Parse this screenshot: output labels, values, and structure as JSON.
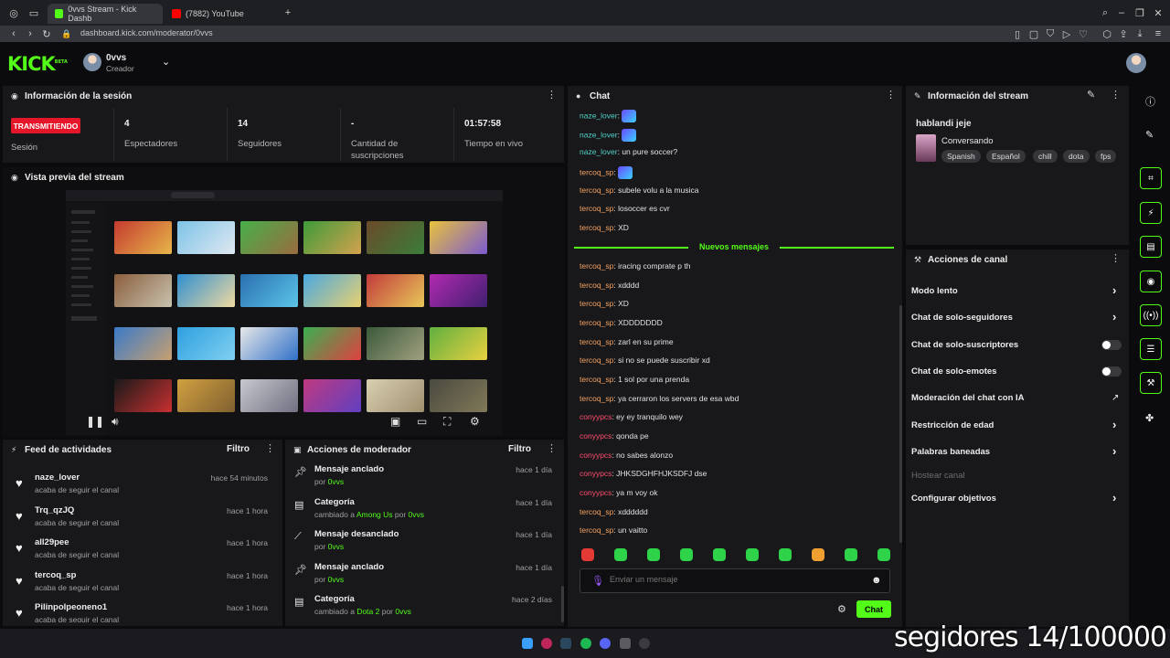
{
  "browser": {
    "tabs": [
      {
        "label": "0vvs Stream - Kick Dashb",
        "active": true
      },
      {
        "label": "(7882) YouTube",
        "active": false
      }
    ],
    "url": "dashboard.kick.com/moderator/0vvs"
  },
  "header": {
    "logo": "KICK",
    "logo_badge": "BETA",
    "user_name": "0vvs",
    "user_role": "Creador"
  },
  "session": {
    "title": "Información de la sesión",
    "live_badge": "TRANSMITIENDO",
    "live_label": "Sesión",
    "stats": [
      {
        "value": "4",
        "label": "Espectadores"
      },
      {
        "value": "14",
        "label": "Seguidores"
      },
      {
        "value": "-",
        "label": "Cantidad de suscripciones"
      },
      {
        "value": "01:57:58",
        "label": "Tiempo en vivo"
      }
    ]
  },
  "preview": {
    "title": "Vista previa del stream"
  },
  "feed": {
    "title": "Feed de actividades",
    "filter": "Filtro",
    "items": [
      {
        "name": "naze_lover",
        "sub": "acaba de seguir el canal",
        "time": "hace 54 minutos"
      },
      {
        "name": "Trq_qzJQ",
        "sub": "acaba de seguir el canal",
        "time": "hace 1 hora"
      },
      {
        "name": "all29pee",
        "sub": "acaba de seguir el canal",
        "time": "hace 1 hora"
      },
      {
        "name": "tercoq_sp",
        "sub": "acaba de seguir el canal",
        "time": "hace 1 hora"
      },
      {
        "name": "Pilinpolpeoneno1",
        "sub": "acaba de seguir el canal",
        "time": "hace 1 hora"
      }
    ]
  },
  "mod_actions": {
    "title": "Acciones de moderador",
    "filter": "Filtro",
    "items": [
      {
        "icon": "pin-icon",
        "name": "Mensaje anclado",
        "pre": "por ",
        "hl1": "0vvs",
        "mid": "",
        "hl2": "",
        "time": "hace 1 día"
      },
      {
        "icon": "category-icon",
        "name": "Categoría",
        "pre": "cambiado a ",
        "hl1": "Among Us",
        "mid": " por ",
        "hl2": "0vvs",
        "time": "hace 1 día"
      },
      {
        "icon": "unpin-icon",
        "name": "Mensaje desanclado",
        "pre": "por ",
        "hl1": "0vvs",
        "mid": "",
        "hl2": "",
        "time": "hace 1 día"
      },
      {
        "icon": "pin-icon",
        "name": "Mensaje anclado",
        "pre": "por ",
        "hl1": "0vvs",
        "mid": "",
        "hl2": "",
        "time": "hace 1 día"
      },
      {
        "icon": "category-icon",
        "name": "Categoría",
        "pre": "cambiado a ",
        "hl1": "Dota 2",
        "mid": " por ",
        "hl2": "0vvs",
        "time": "hace 2 días"
      }
    ]
  },
  "chat": {
    "title": "Chat",
    "new_messages": "Nuevos mensajes",
    "input_placeholder": "Enviar un mensaje",
    "send_label": "Chat",
    "messages": [
      {
        "user": "naze_lover",
        "color": "#4fd1c5",
        "text": "",
        "emote": true
      },
      {
        "user": "naze_lover",
        "color": "#4fd1c5",
        "text": "",
        "emote": true
      },
      {
        "user": "naze_lover",
        "color": "#4fd1c5",
        "text": "un pure soccer?",
        "emote": false
      },
      {
        "user": "tercoq_sp",
        "color": "#f4a261",
        "text": "",
        "emote": true
      },
      {
        "user": "tercoq_sp",
        "color": "#f4a261",
        "text": "subele volu a la musica",
        "emote": false
      },
      {
        "user": "tercoq_sp",
        "color": "#f4a261",
        "text": "losoccer es cvr",
        "emote": false
      },
      {
        "user": "tercoq_sp",
        "color": "#f4a261",
        "text": "XD",
        "emote": false
      },
      {
        "user": "tercoq_sp",
        "color": "#f4a261",
        "text": "iracing comprate p th",
        "emote": false
      },
      {
        "user": "tercoq_sp",
        "color": "#f4a261",
        "text": "xdddd",
        "emote": false
      },
      {
        "user": "tercoq_sp",
        "color": "#f4a261",
        "text": "XD",
        "emote": false
      },
      {
        "user": "tercoq_sp",
        "color": "#f4a261",
        "text": "XDDDDDDD",
        "emote": false
      },
      {
        "user": "tercoq_sp",
        "color": "#f4a261",
        "text": "zarl en su prime",
        "emote": false
      },
      {
        "user": "tercoq_sp",
        "color": "#f4a261",
        "text": "si no se puede suscribir xd",
        "emote": false
      },
      {
        "user": "tercoq_sp",
        "color": "#f4a261",
        "text": "1 sol por una prenda",
        "emote": false
      },
      {
        "user": "tercoq_sp",
        "color": "#f4a261",
        "text": "ya cerraron los servers de esa wbd",
        "emote": false
      },
      {
        "user": "conyypcs",
        "color": "#ff4d6d",
        "text": "ey ey tranquilo wey",
        "emote": false
      },
      {
        "user": "conyypcs",
        "color": "#ff4d6d",
        "text": "qonda pe",
        "emote": false
      },
      {
        "user": "conyypcs",
        "color": "#ff4d6d",
        "text": "no sabes alonzo",
        "emote": false
      },
      {
        "user": "conyypcs",
        "color": "#ff4d6d",
        "text": "JHKSDGHFHJKSDFJ dse",
        "emote": false
      },
      {
        "user": "conyypcs",
        "color": "#ff4d6d",
        "text": "ya m voy ok",
        "emote": false
      },
      {
        "user": "tercoq_sp",
        "color": "#f4a261",
        "text": "xdddddd",
        "emote": false
      },
      {
        "user": "tercoq_sp",
        "color": "#f4a261",
        "text": "un vaitto",
        "emote": false
      }
    ]
  },
  "stream_info": {
    "title": "Información del stream",
    "stream_title": "hablandi jeje",
    "category": "Conversando",
    "tags": [
      "Spanish",
      "Español",
      "chill",
      "dota",
      "fps"
    ]
  },
  "channel_actions": {
    "title": "Acciones de canal",
    "items": [
      {
        "label": "Modo lento",
        "control": "chevron"
      },
      {
        "label": "Chat de solo-seguidores",
        "control": "chevron"
      },
      {
        "label": "Chat de solo-suscriptores",
        "control": "toggle"
      },
      {
        "label": "Chat de solo-emotes",
        "control": "toggle"
      },
      {
        "label": "Moderación del chat con IA",
        "control": "external"
      },
      {
        "label": "Restricción de edad",
        "control": "chevron"
      },
      {
        "label": "Palabras baneadas",
        "control": "chevron"
      },
      {
        "label": "Hostear canal",
        "control": "disabled"
      },
      {
        "label": "Configurar objetivos",
        "control": "chevron"
      }
    ]
  },
  "overlay_text": "segidores 14/100000",
  "colors": {
    "accent": "#53fc18",
    "live": "#e5162a",
    "panel": "#18181b"
  }
}
